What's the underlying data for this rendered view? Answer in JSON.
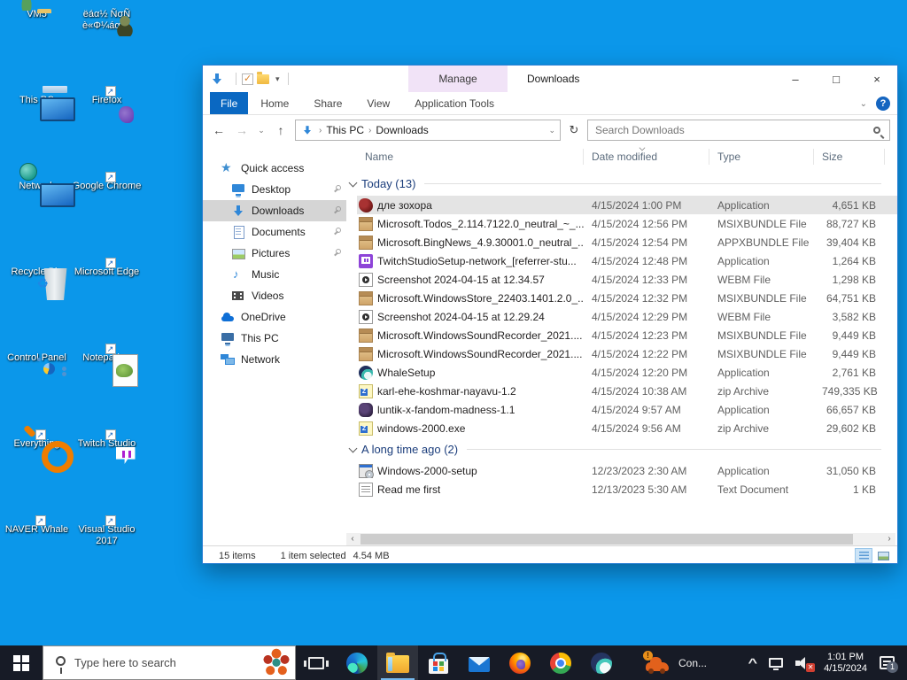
{
  "desktop": {
    "icons": [
      {
        "label": "VM5",
        "icon": "vm-folder",
        "shortcut": false
      },
      {
        "label": "ëáα½ ÑσÑ è«Φ¼áα ...",
        "icon": "image-thumb",
        "shortcut": false
      },
      {
        "label": "This PC",
        "icon": "this-pc",
        "shortcut": false
      },
      {
        "label": "Firefox",
        "icon": "firefox",
        "shortcut": true
      },
      {
        "label": "Network",
        "icon": "network",
        "shortcut": false
      },
      {
        "label": "Google Chrome",
        "icon": "chrome",
        "shortcut": true
      },
      {
        "label": "Recycle Bin",
        "icon": "recycle-bin",
        "shortcut": false
      },
      {
        "label": "Microsoft Edge",
        "icon": "edge",
        "shortcut": true
      },
      {
        "label": "Control Panel",
        "icon": "control-panel",
        "shortcut": false
      },
      {
        "label": "Notepad++",
        "icon": "notepadpp",
        "shortcut": true
      },
      {
        "label": "Everything",
        "icon": "everything",
        "shortcut": true
      },
      {
        "label": "Twitch Studio",
        "icon": "twitch-studio",
        "shortcut": true
      },
      {
        "label": "NAVER Whale",
        "icon": "naver-whale",
        "shortcut": true
      },
      {
        "label": "Visual Studio 2017",
        "icon": "visual-studio",
        "shortcut": true
      }
    ]
  },
  "explorer": {
    "title": "Downloads",
    "contextual_tab": "Manage",
    "tabs": [
      "File",
      "Home",
      "Share",
      "View",
      "Application Tools"
    ],
    "window_controls": {
      "minimize": "–",
      "maximize": "□",
      "close": "×"
    },
    "nav": {
      "breadcrumb": [
        "This PC",
        "Downloads"
      ],
      "search_placeholder": "Search Downloads"
    },
    "sidebar": [
      {
        "label": "Quick access",
        "icon": "star",
        "level": 0,
        "pinned": false,
        "selected": false
      },
      {
        "label": "Desktop",
        "icon": "desktop",
        "level": 1,
        "pinned": true,
        "selected": false
      },
      {
        "label": "Downloads",
        "icon": "downloads",
        "level": 1,
        "pinned": true,
        "selected": true
      },
      {
        "label": "Documents",
        "icon": "documents",
        "level": 1,
        "pinned": true,
        "selected": false
      },
      {
        "label": "Pictures",
        "icon": "pictures",
        "level": 1,
        "pinned": true,
        "selected": false
      },
      {
        "label": "Music",
        "icon": "music",
        "level": 1,
        "pinned": false,
        "selected": false
      },
      {
        "label": "Videos",
        "icon": "videos",
        "level": 1,
        "pinned": false,
        "selected": false
      },
      {
        "label": "OneDrive",
        "icon": "onedrive",
        "level": 0,
        "pinned": false,
        "selected": false
      },
      {
        "label": "This PC",
        "icon": "this-pc",
        "level": 0,
        "pinned": false,
        "selected": false
      },
      {
        "label": "Network",
        "icon": "network",
        "level": 0,
        "pinned": false,
        "selected": false
      }
    ],
    "columns": [
      "Name",
      "Date modified",
      "Type",
      "Size"
    ],
    "sort_column": "Date modified",
    "groups": [
      {
        "label": "Today (13)",
        "rows": [
          {
            "name": "дле зохора",
            "date": "4/15/2024 1:00 PM",
            "type": "Application",
            "size": "4,651 KB",
            "icon": "sprite-red",
            "selected": true
          },
          {
            "name": "Microsoft.Todos_2.114.7122.0_neutral_~_...",
            "date": "4/15/2024 12:56 PM",
            "type": "MSIXBUNDLE File",
            "size": "88,727 KB",
            "icon": "box",
            "selected": false
          },
          {
            "name": "Microsoft.BingNews_4.9.30001.0_neutral_...",
            "date": "4/15/2024 12:54 PM",
            "type": "APPXBUNDLE File",
            "size": "39,404 KB",
            "icon": "box",
            "selected": false
          },
          {
            "name": "TwitchStudioSetup-network_[referrer-stu...",
            "date": "4/15/2024 12:48 PM",
            "type": "Application",
            "size": "1,264 KB",
            "icon": "twitch",
            "selected": false
          },
          {
            "name": "Screenshot 2024-04-15 at 12.34.57",
            "date": "4/15/2024 12:33 PM",
            "type": "WEBM File",
            "size": "1,298 KB",
            "icon": "media",
            "selected": false
          },
          {
            "name": "Microsoft.WindowsStore_22403.1401.2.0_...",
            "date": "4/15/2024 12:32 PM",
            "type": "MSIXBUNDLE File",
            "size": "64,751 KB",
            "icon": "box",
            "selected": false
          },
          {
            "name": "Screenshot 2024-04-15 at 12.29.24",
            "date": "4/15/2024 12:29 PM",
            "type": "WEBM File",
            "size": "3,582 KB",
            "icon": "media",
            "selected": false
          },
          {
            "name": "Microsoft.WindowsSoundRecorder_2021....",
            "date": "4/15/2024 12:23 PM",
            "type": "MSIXBUNDLE File",
            "size": "9,449 KB",
            "icon": "box",
            "selected": false
          },
          {
            "name": "Microsoft.WindowsSoundRecorder_2021....",
            "date": "4/15/2024 12:22 PM",
            "type": "MSIXBUNDLE File",
            "size": "9,449 KB",
            "icon": "box",
            "selected": false
          },
          {
            "name": "WhaleSetup",
            "date": "4/15/2024 12:20 PM",
            "type": "Application",
            "size": "2,761 KB",
            "icon": "whale",
            "selected": false
          },
          {
            "name": "karl-ehe-koshmar-nayavu-1.2",
            "date": "4/15/2024 10:38 AM",
            "type": "zip Archive",
            "size": "749,335 KB",
            "icon": "zip",
            "selected": false
          },
          {
            "name": "luntik-x-fandom-madness-1.1",
            "date": "4/15/2024 9:57 AM",
            "type": "Application",
            "size": "66,657 KB",
            "icon": "sprite-purple",
            "selected": false
          },
          {
            "name": "windows-2000.exe",
            "date": "4/15/2024 9:56 AM",
            "type": "zip Archive",
            "size": "29,602 KB",
            "icon": "zip",
            "selected": false
          }
        ]
      },
      {
        "label": "A long time ago (2)",
        "rows": [
          {
            "name": "Windows-2000-setup",
            "date": "12/23/2023 2:30 AM",
            "type": "Application",
            "size": "31,050 KB",
            "icon": "installer",
            "selected": false
          },
          {
            "name": "Read me first",
            "date": "12/13/2023 5:30 AM",
            "type": "Text Document",
            "size": "1 KB",
            "icon": "text",
            "selected": false
          }
        ]
      }
    ],
    "status": {
      "items": "15 items",
      "selection": "1 item selected",
      "selection_size": "4.54 MB"
    }
  },
  "taskbar": {
    "search_placeholder": "Type here to search",
    "apps": [
      {
        "name": "edge",
        "active": false
      },
      {
        "name": "explorer",
        "active": true
      },
      {
        "name": "store",
        "active": false
      },
      {
        "name": "mail",
        "active": false
      },
      {
        "name": "firefox",
        "active": false
      },
      {
        "name": "chrome",
        "active": false
      },
      {
        "name": "whale",
        "active": false
      }
    ],
    "running_app": {
      "label": "Con...",
      "warning": "!"
    },
    "tray": {
      "clock_time": "1:01 PM",
      "clock_date": "4/15/2024",
      "notification_count": "1"
    }
  }
}
